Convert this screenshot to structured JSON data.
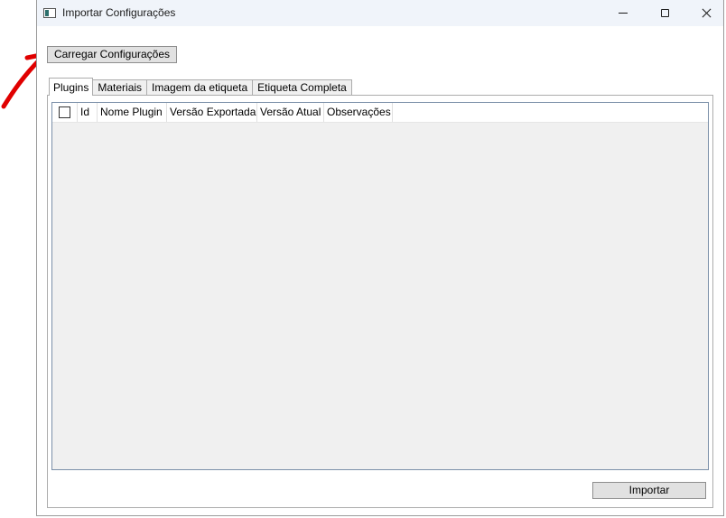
{
  "window": {
    "title": "Importar Configurações"
  },
  "toolbar": {
    "load_label": "Carregar Configurações"
  },
  "tabs": [
    {
      "label": "Plugins",
      "active": true
    },
    {
      "label": "Materiais",
      "active": false
    },
    {
      "label": "Imagem da etiqueta",
      "active": false
    },
    {
      "label": "Etiqueta Completa",
      "active": false
    }
  ],
  "grid": {
    "columns": [
      "Id",
      "Nome Plugin",
      "Versão Exportada",
      "Versão Atual",
      "Observações"
    ],
    "select_all_checked": false,
    "rows": []
  },
  "footer": {
    "import_label": "Importar"
  },
  "colors": {
    "annotation_arrow": "#e00000",
    "titlebar_bg": "#f0f4fa",
    "button_bg": "#e1e1e1",
    "grid_bg": "#f0f0f0"
  },
  "icons": {
    "app": "app-window-icon",
    "minimize": "minimize-icon",
    "maximize": "maximize-icon",
    "close": "close-icon",
    "annotation": "red-arrow-icon"
  }
}
